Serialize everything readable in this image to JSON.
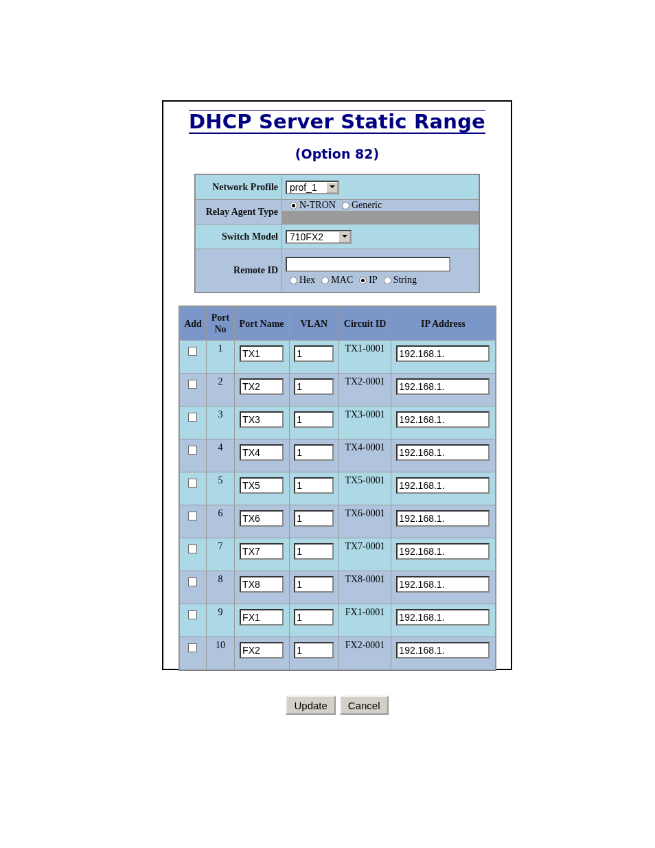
{
  "title": "DHCP Server Static Range",
  "subtitle": "(Option 82)",
  "form": {
    "network_profile": {
      "label": "Network Profile",
      "value": "prof_1"
    },
    "relay_agent_type": {
      "label": "Relay Agent Type",
      "options": [
        {
          "label": "N-TRON",
          "selected": true
        },
        {
          "label": "Generic",
          "selected": false
        }
      ]
    },
    "switch_model": {
      "label": "Switch Model",
      "value": "710FX2"
    },
    "remote_id": {
      "label": "Remote ID",
      "options": [
        {
          "label": "Hex",
          "selected": false
        },
        {
          "label": "MAC",
          "selected": false
        },
        {
          "label": "IP",
          "selected": true
        },
        {
          "label": "String",
          "selected": false
        }
      ]
    }
  },
  "table": {
    "columns": [
      "Add",
      "Port No",
      "Port Name",
      "VLAN",
      "Circuit ID",
      "IP Address"
    ],
    "rows": [
      {
        "checked": false,
        "port_no": "1",
        "port_name": "TX1",
        "vlan": "1",
        "circuit_id": "TX1-0001",
        "ip_address": "192.168.1."
      },
      {
        "checked": false,
        "port_no": "2",
        "port_name": "TX2",
        "vlan": "1",
        "circuit_id": "TX2-0001",
        "ip_address": "192.168.1."
      },
      {
        "checked": false,
        "port_no": "3",
        "port_name": "TX3",
        "vlan": "1",
        "circuit_id": "TX3-0001",
        "ip_address": "192.168.1."
      },
      {
        "checked": false,
        "port_no": "4",
        "port_name": "TX4",
        "vlan": "1",
        "circuit_id": "TX4-0001",
        "ip_address": "192.168.1."
      },
      {
        "checked": false,
        "port_no": "5",
        "port_name": "TX5",
        "vlan": "1",
        "circuit_id": "TX5-0001",
        "ip_address": "192.168.1."
      },
      {
        "checked": false,
        "port_no": "6",
        "port_name": "TX6",
        "vlan": "1",
        "circuit_id": "TX6-0001",
        "ip_address": "192.168.1."
      },
      {
        "checked": false,
        "port_no": "7",
        "port_name": "TX7",
        "vlan": "1",
        "circuit_id": "TX7-0001",
        "ip_address": "192.168.1."
      },
      {
        "checked": false,
        "port_no": "8",
        "port_name": "TX8",
        "vlan": "1",
        "circuit_id": "TX8-0001",
        "ip_address": "192.168.1."
      },
      {
        "checked": false,
        "port_no": "9",
        "port_name": "FX1",
        "vlan": "1",
        "circuit_id": "FX1-0001",
        "ip_address": "192.168.1."
      },
      {
        "checked": false,
        "port_no": "10",
        "port_name": "FX2",
        "vlan": "1",
        "circuit_id": "FX2-0001",
        "ip_address": "192.168.1."
      }
    ]
  },
  "buttons": [
    "Update",
    "Cancel"
  ]
}
